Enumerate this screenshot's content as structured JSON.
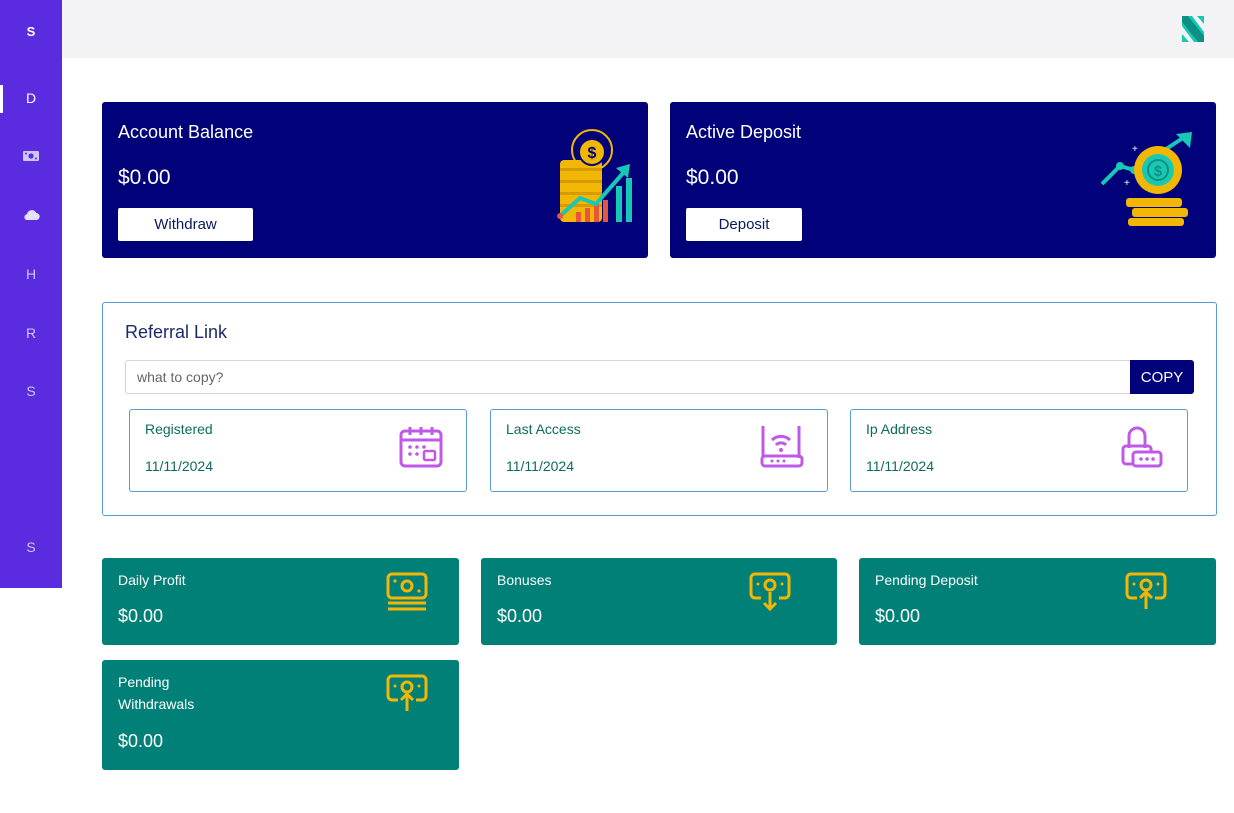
{
  "sidebar": {
    "brand": "S",
    "items": [
      {
        "label": "D",
        "icon": null
      },
      {
        "label": "",
        "icon": "money-icon"
      },
      {
        "label": "",
        "icon": "cloud-icon"
      },
      {
        "label": "H",
        "icon": null
      },
      {
        "label": "R",
        "icon": null
      },
      {
        "label": "S",
        "icon": null
      }
    ],
    "bottom_item": "S"
  },
  "colors": {
    "sidebar": "#5b2be0",
    "dark_card": "#01017a",
    "stat_card": "#018077",
    "accent_teal": "#17c9b4",
    "icon_gold": "#f2b705",
    "icon_purple": "#c058e8"
  },
  "balance_cards": [
    {
      "title": "Account Balance",
      "amount": "$0.00",
      "button": "Withdraw",
      "icon": "coins-growth-chart-icon"
    },
    {
      "title": "Active Deposit",
      "amount": "$0.00",
      "button": "Deposit",
      "icon": "coin-investment-growth-icon"
    }
  ],
  "referral": {
    "title": "Referral Link",
    "placeholder": "what to copy?",
    "value": "",
    "copy_label": "COPY"
  },
  "info": [
    {
      "label": "Registered",
      "value": "11/11/2024",
      "icon": "calendar-icon"
    },
    {
      "label": "Last Access",
      "value": "11/11/2024",
      "icon": "wifi-router-icon"
    },
    {
      "label": "Ip Address",
      "value": "11/11/2024",
      "icon": "network-device-icon"
    }
  ],
  "stats": [
    {
      "title": "Daily Profit",
      "amount": "$0.00",
      "icon": "cash-icon"
    },
    {
      "title": "Bonuses",
      "amount": "$0.00",
      "icon": "withdraw-cash-icon"
    },
    {
      "title": "Pending Deposit",
      "amount": "$0.00",
      "icon": "deposit-cash-icon"
    },
    {
      "title": "Pending\nWithdrawals",
      "amount": "$0.00",
      "icon": "deposit-cash-icon"
    }
  ]
}
